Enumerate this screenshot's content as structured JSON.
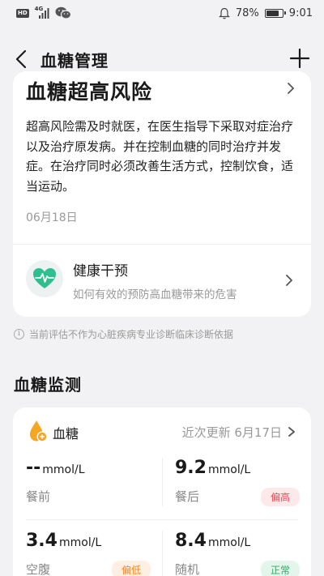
{
  "status_bar": {
    "network": "4G",
    "battery": "78%",
    "battery_level": 0.78,
    "time": "9:01"
  },
  "nav": {
    "title": "血糖管理"
  },
  "risk_card": {
    "title": "血糖超高风险",
    "description": "超高风险需及时就医，在医生指导下采取对症治疗以及治疗原发病。并在控制血糖的同时治疗并发症。在治疗同时必须改善生活方式，控制饮食，适当运动。",
    "date": "06月18日",
    "health_title": "健康干预",
    "health_subtitle": "如何有效的预防高血糖带来的危害"
  },
  "disclaimer": "当前评估不作为心脏疾病专业诊断临床诊断依据",
  "monitor": {
    "section_title": "血糖监测",
    "label": "血糖",
    "update_text": "近次更新 6月17日",
    "readings": [
      {
        "value": "--",
        "unit": "mmol/L",
        "label": "餐前",
        "badge": ""
      },
      {
        "value": "9.2",
        "unit": "mmol/L",
        "label": "餐后",
        "badge": "偏高"
      },
      {
        "value": "3.4",
        "unit": "mmol/L",
        "label": "空腹",
        "badge": "偏低"
      },
      {
        "value": "8.4",
        "unit": "mmol/L",
        "label": "随机",
        "badge": "正常"
      }
    ]
  },
  "colors": {
    "high": "#e84a5a",
    "low": "#f08a22",
    "normal": "#2fab6a",
    "accent_orange": "#f5a623",
    "heart_green": "#2fbf8f"
  }
}
